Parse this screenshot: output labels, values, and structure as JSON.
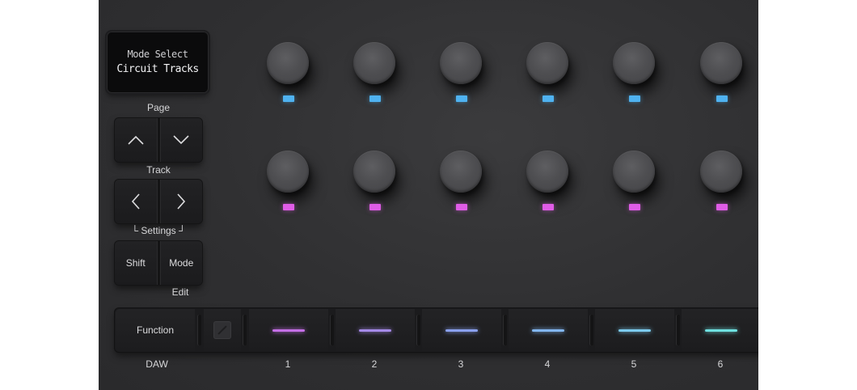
{
  "screen": {
    "line1": "Mode Select",
    "line2": "Circuit Tracks"
  },
  "labels": {
    "page": "Page",
    "track": "Track",
    "settings": "└ Settings ┘",
    "edit": "Edit",
    "daw": "DAW"
  },
  "buttons": {
    "page_up_icon": "chevron-up-icon",
    "page_down_icon": "chevron-down-icon",
    "track_left_icon": "chevron-left-icon",
    "track_right_icon": "chevron-right-icon",
    "shift": "Shift",
    "mode": "Mode",
    "function": "Function"
  },
  "knob_rows": [
    {
      "led_color": "#4fb2f0"
    },
    {
      "led_color": "#df5ce6"
    }
  ],
  "pads": [
    {
      "number": "1",
      "color": "#c46fe6"
    },
    {
      "number": "2",
      "color": "#a58ae8"
    },
    {
      "number": "3",
      "color": "#8aa0ee"
    },
    {
      "number": "4",
      "color": "#82b6f0"
    },
    {
      "number": "5",
      "color": "#7ccbee"
    },
    {
      "number": "6",
      "color": "#6fe0e0"
    }
  ]
}
